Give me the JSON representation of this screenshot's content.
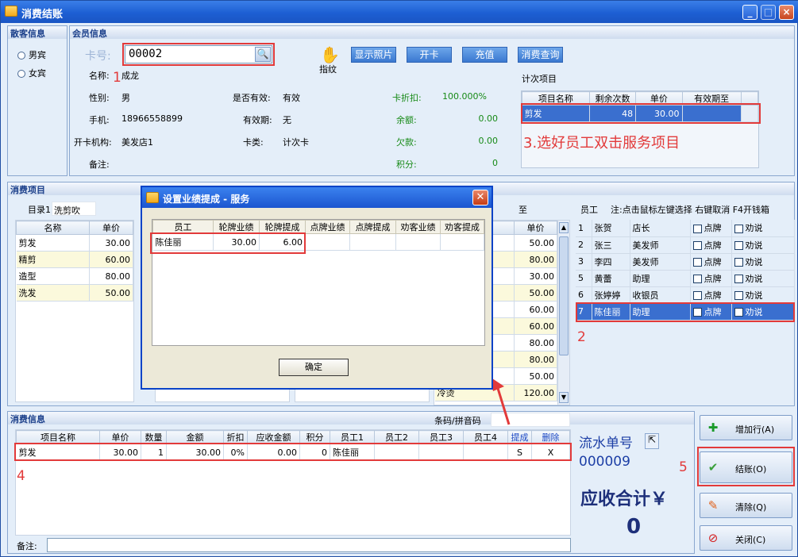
{
  "window": {
    "title": "消费结账"
  },
  "guest": {
    "header": "散客信息",
    "male": "男宾",
    "female": "女宾"
  },
  "member": {
    "header": "会员信息",
    "card_label": "卡号:",
    "card_value": "00002",
    "fingerprint_label": "指纹",
    "buttons": {
      "photo": "显示照片",
      "open_card": "开卡",
      "recharge": "充值",
      "history": "消费查询"
    },
    "name_label": "名称:",
    "name_value": "成龙",
    "gender_label": "性别:",
    "gender_value": "男",
    "valid_label": "是否有效:",
    "valid_value": "有效",
    "discount_label": "卡折扣:",
    "discount_value": "100.000%",
    "phone_label": "手机:",
    "phone_value": "18966558899",
    "expiry_label": "有效期:",
    "expiry_value": "无",
    "balance_label": "余额:",
    "balance_value": "0.00",
    "org_label": "开卡机构:",
    "org_value": "美发店1",
    "card_type_label": "卡类:",
    "card_type_value": "计次卡",
    "debt_label": "欠款:",
    "debt_value": "0.00",
    "note_label": "备注:",
    "points_label": "积分:",
    "points_value": "0",
    "count_items_title": "计次项目",
    "count_headers": [
      "项目名称",
      "剩余次数",
      "单价",
      "有效期至"
    ],
    "count_rows": [
      {
        "name": "剪发",
        "remaining": "48",
        "price": "30.00",
        "expiry": ""
      }
    ]
  },
  "annotations": {
    "n1": "1",
    "n2": "2",
    "n3": "3.选好员工双击服务项目",
    "n4": "4",
    "n5": "5"
  },
  "items": {
    "header": "消费项目",
    "dir_label": "目录1",
    "dir_value": "洗剪吹",
    "headers": [
      "名称",
      "单价"
    ],
    "rows": [
      {
        "name": "剪发",
        "price": "30.00"
      },
      {
        "name": "精剪",
        "price": "60.00"
      },
      {
        "name": "造型",
        "price": "80.00"
      },
      {
        "name": "洗发",
        "price": "50.00"
      }
    ],
    "to_label": "至",
    "col3_header": "单价",
    "col3_rows": [
      {
        "name": "",
        "price": "50.00"
      },
      {
        "name": "",
        "price": "80.00"
      },
      {
        "name": "",
        "price": "30.00"
      },
      {
        "name": "",
        "price": "50.00"
      },
      {
        "name": "",
        "price": "60.00"
      },
      {
        "name": "",
        "price": "60.00"
      },
      {
        "name": "",
        "price": "80.00"
      },
      {
        "name": "",
        "price": "80.00"
      },
      {
        "name": "",
        "price": "50.00"
      },
      {
        "name": "冷烫",
        "price": "120.00"
      }
    ]
  },
  "staff": {
    "title": "员工",
    "hint": "注:点击鼠标左键选择 右键取消 F4开钱箱",
    "rows": [
      {
        "id": "1",
        "name": "张贺",
        "role": "店长"
      },
      {
        "id": "2",
        "name": "张三",
        "role": "美发师"
      },
      {
        "id": "3",
        "name": "李四",
        "role": "美发师"
      },
      {
        "id": "5",
        "name": "黄蕾",
        "role": "助理"
      },
      {
        "id": "6",
        "name": "张婷婷",
        "role": "收银员"
      },
      {
        "id": "7",
        "name": "陈佳丽",
        "role": "助理"
      }
    ],
    "rank_label": "点牌",
    "persuade_label": "劝说"
  },
  "dialog": {
    "title": "设置业绩提成 - 服务",
    "headers": [
      "员工",
      "轮牌业绩",
      "轮牌提成",
      "点牌业绩",
      "点牌提成",
      "劝客业绩",
      "劝客提成"
    ],
    "rows": [
      {
        "staff": "陈佳丽",
        "rotate_perf": "30.00",
        "rotate_comm": "6.00",
        "pick_perf": "",
        "pick_comm": "",
        "persuade_perf": "",
        "persuade_comm": ""
      }
    ],
    "ok": "确定"
  },
  "consume": {
    "header": "消费信息",
    "barcode_label": "条码/拼音码",
    "headers": [
      "项目名称",
      "单价",
      "数量",
      "金额",
      "折扣",
      "应收金额",
      "积分",
      "员工1",
      "员工2",
      "员工3",
      "员工4",
      "提成",
      "删除"
    ],
    "rows": [
      {
        "name": "剪发",
        "price": "30.00",
        "qty": "1",
        "amount": "30.00",
        "discount": "0%",
        "receivable": "0.00",
        "points": "0",
        "s1": "陈佳丽",
        "s2": "",
        "s3": "",
        "s4": "",
        "comm": "S",
        "del": "X"
      }
    ],
    "note_label": "备注:"
  },
  "summary": {
    "serial_label": "流水单号",
    "serial_value": "000009",
    "total_label": "应收合计￥",
    "total_value": "0"
  },
  "actions": {
    "add_row": "增加行(A)",
    "checkout": "结账(O)",
    "clear": "清除(Q)",
    "close": "关闭(C)"
  }
}
